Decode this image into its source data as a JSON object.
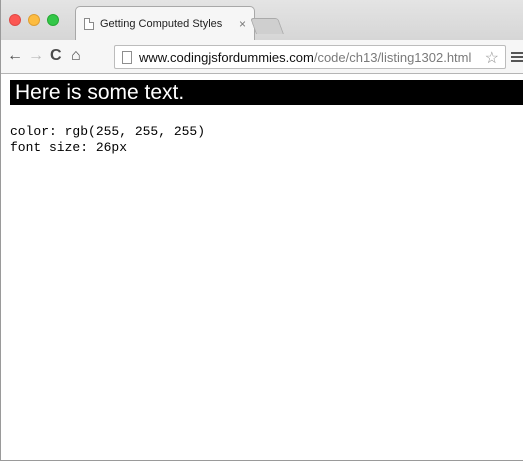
{
  "browser": {
    "tab": {
      "title": "Getting Computed Styles",
      "close_glyph": "×"
    },
    "toolbar": {
      "back_glyph": "←",
      "forward_glyph": "→",
      "reload_glyph": "C",
      "home_glyph": "⌂",
      "url_host": "www.codingjsfordummies.com",
      "url_path": "/code/ch13/listing1302.html",
      "star_glyph": "☆"
    },
    "colors": {
      "close": "#fc5753",
      "minimize": "#fdbc40",
      "maximize": "#33c748"
    }
  },
  "page": {
    "banner_text": "Here is some text.",
    "output": [
      "color: rgb(255, 255, 255)",
      "font size: 26px"
    ]
  }
}
